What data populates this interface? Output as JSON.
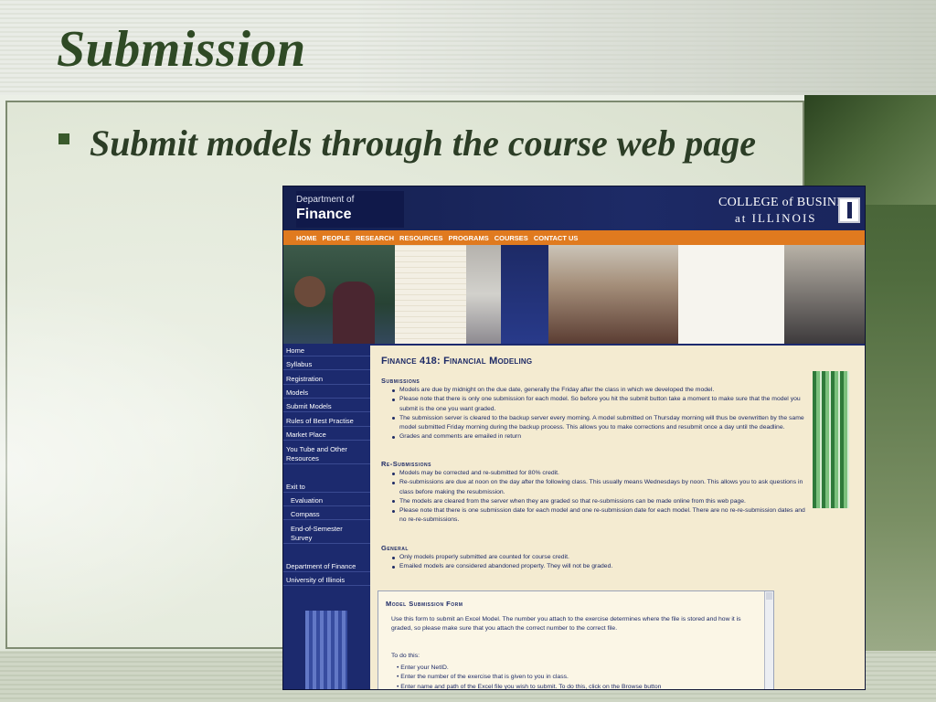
{
  "slide": {
    "title": "Submission",
    "bullet": "Submit models through the course web page"
  },
  "site": {
    "header": {
      "dept_line1": "Department of",
      "dept_line2": "Finance",
      "college_line1": "COLLEGE of BUSINESS",
      "college_line2": "at ILLINOIS"
    },
    "nav": [
      "HOME",
      "PEOPLE",
      "RESEARCH",
      "RESOURCES",
      "PROGRAMS",
      "COURSES",
      "CONTACT US"
    ],
    "sidebar": {
      "home": "Home",
      "syllabus": "Syllabus",
      "registration": "Registration",
      "models": "Models",
      "submit_models": "Submit Models",
      "rules": "Rules of Best Practise",
      "market_place": "Market Place",
      "youtube_1": "You Tube and Other",
      "youtube_2": "Resources",
      "exit_to": "Exit to",
      "evaluation": "Evaluation",
      "compass": "Compass",
      "survey_1": "End-of-Semester",
      "survey_2": "Survey",
      "dept_finance": "Department of Finance",
      "uiuc": "University of Illinois"
    },
    "main": {
      "page_title": "Finance 418: Financial Modeling",
      "submissions": {
        "heading": "Submissions",
        "b1": "Models are due by midnight on the due date, generally the Friday after the class in which we developed the model.",
        "b2": "Please note that there is only one submission for each model. So before you hit the submit button take a moment to make sure that the model you submit is the one you want graded.",
        "b3": "The submission server is cleared to the backup server every morning. A model submitted on Thursday morning will thus be overwritten by the same model submitted Friday morning during the backup process. This allows you to make corrections and resubmit once a day until the deadline.",
        "b4": "Grades and comments are emailed in return"
      },
      "resubmissions": {
        "heading": "Re-Submissions",
        "b1": "Models may be corrected and re-submitted for 80% credit.",
        "b2": "Re-submissions are due at noon on the day after the following class. This usually means Wednesdays by noon. This allows you to ask questions in class before making the resubmission.",
        "b3": "The models are cleared from the server when they are graded so that re-submissions can be made online from this web page.",
        "b4": "Please note that there is one submission date for each model and one re-submission date for each model. There are no re-re-submission dates and no re-re-submissions."
      },
      "general": {
        "heading": "General",
        "b1": "Only models properly submitted are counted for course credit.",
        "b2": "Emailed models are considered abandoned property. They will not be graded."
      },
      "form": {
        "title": "Model Submission Form",
        "intro": "Use this form to submit an Excel Model. The number you attach to the exercise determines where the file is stored and how it is graded, so please make sure that you attach the correct number to the correct file.",
        "todo": "To do this:",
        "step1": "Enter your NetID.",
        "step2": "Enter the number of the exercise that is given to you in class.",
        "step3": "Enter name and path of the Excel file you wish to submit.  To do this, click on the Browse button"
      }
    }
  }
}
